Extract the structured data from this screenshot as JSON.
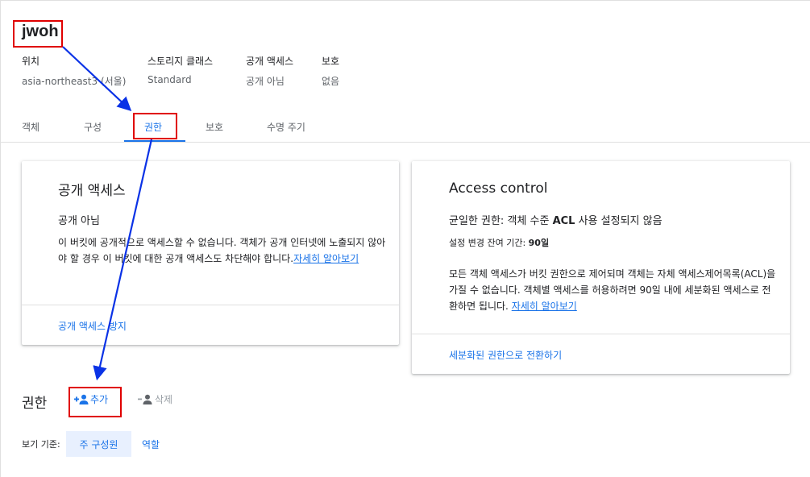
{
  "bucket": {
    "name": "jwoh"
  },
  "meta": [
    {
      "label": "위치",
      "value": "asia-northeast3 (서울)"
    },
    {
      "label": "스토리지 클래스",
      "value": "Standard"
    },
    {
      "label": "공개 액세스",
      "value": "공개 아님"
    },
    {
      "label": "보호",
      "value": "없음"
    }
  ],
  "tabs": [
    {
      "label": "객체"
    },
    {
      "label": "구성"
    },
    {
      "label": "권한"
    },
    {
      "label": "보호"
    },
    {
      "label": "수명 주기"
    }
  ],
  "public_card": {
    "title": "공개 액세스",
    "status": "공개 아님",
    "description": "이 버킷에 공개적으로 액세스할 수 없습니다. 객체가 공개 인터넷에 노출되지 않아야 할 경우 이 버킷에 대한 공개 액세스도 차단해야 합니다.",
    "learn_more": "자세히 알아보기",
    "action": "공개 액세스 방지"
  },
  "acl_card": {
    "title": "Access control",
    "status_prefix": "균일한 권한: 객체 수준",
    "status_bold": "ACL",
    "status_suffix": "사용 설정되지 않음",
    "remaining_label": "설정 변경 잔여 기간:",
    "remaining_value": "90일",
    "description": "모든 객체 액세스가 버킷 권한으로 제어되며 객체는 자체 액세스제어목록(ACL)을 가질 수 없습니다. 객체별 액세스를 허용하려면 90일 내에 세분화된 액세스로 전환하면 됩니다.",
    "learn_more": "자세히 알아보기",
    "action": "세분화된 권한으로 전환하기"
  },
  "permissions": {
    "title": "권한",
    "add_label": "추가",
    "remove_label": "삭제",
    "view_by_label": "보기 기준:",
    "view_options": [
      "주 구성원",
      "역할"
    ]
  },
  "colors": {
    "accent": "#1a73e8",
    "annotation_box": "#e00000",
    "annotation_arrow": "#0a32e6"
  }
}
